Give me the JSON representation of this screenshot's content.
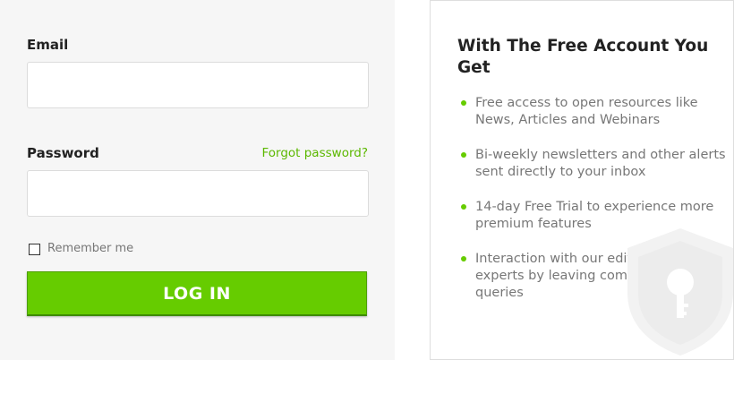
{
  "login": {
    "email_label": "Email",
    "email_value": "",
    "password_label": "Password",
    "password_value": "",
    "forgot_password": "Forgot password?",
    "remember_label": "Remember me",
    "remember_checked": false,
    "login_button": "LOG IN"
  },
  "benefits": {
    "title": "With The Free Account You Get",
    "items": [
      "Free access to open resources like News, Articles and Webinars",
      "Bi-weekly newsletters and other alerts sent directly to your inbox",
      "14-day Free Trial to experience more premium features",
      "Interaction with our editors and experts by leaving comments or queries"
    ],
    "watermark_icon": "shield-keyhole-icon"
  },
  "colors": {
    "accent": "#66cc00",
    "link": "#5cb800",
    "panel_background": "#f6f6f6"
  }
}
